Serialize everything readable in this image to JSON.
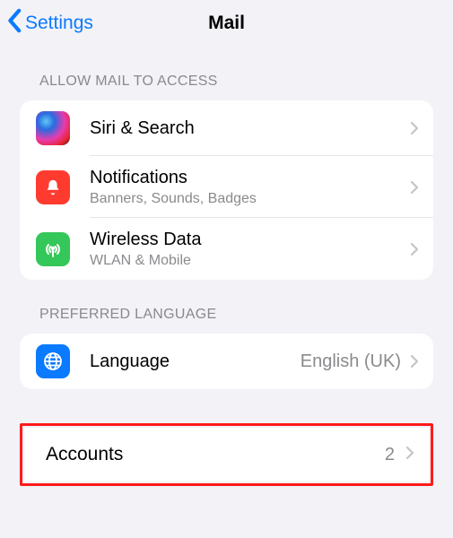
{
  "nav": {
    "back_label": "Settings",
    "title": "Mail"
  },
  "section1_header": "ALLOW MAIL TO ACCESS",
  "rows": {
    "siri": {
      "label": "Siri & Search"
    },
    "notif": {
      "label": "Notifications",
      "sub": "Banners, Sounds, Badges"
    },
    "wireless": {
      "label": "Wireless Data",
      "sub": "WLAN & Mobile"
    }
  },
  "section2_header": "PREFERRED LANGUAGE",
  "language": {
    "label": "Language",
    "value": "English (UK)"
  },
  "accounts": {
    "label": "Accounts",
    "value": "2"
  }
}
